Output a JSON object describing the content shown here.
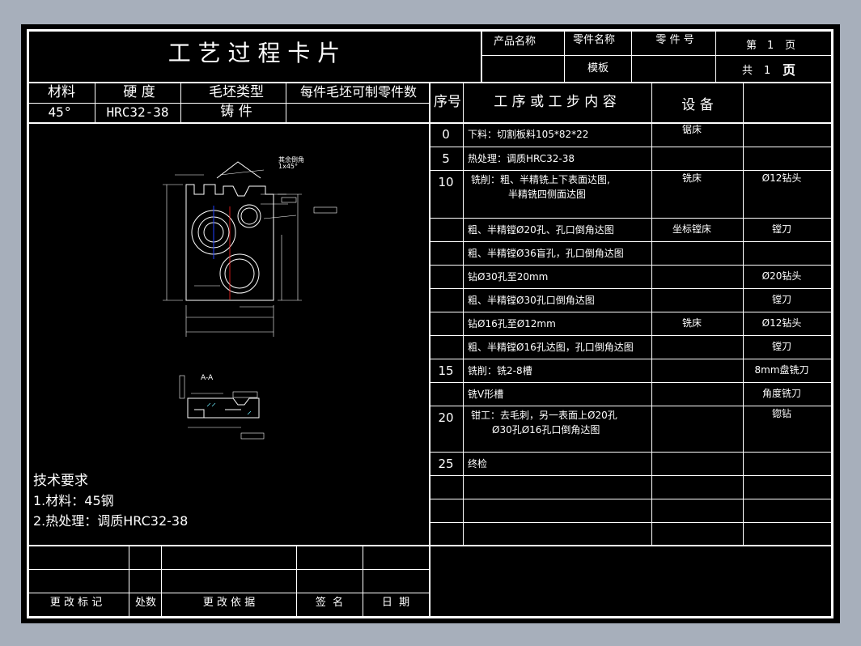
{
  "title": "工 艺 过 程 卡 片",
  "header": {
    "product_name_label": "产品名称",
    "part_name_label": "零件名称",
    "part_no_label": "零 件 号",
    "template_label": "模板",
    "sheet_label": "第",
    "sheet_no": "1",
    "sheet_unit": "页",
    "total_label": "共",
    "total_no": "1",
    "total_unit": "页"
  },
  "material_table": {
    "headers": [
      "材料",
      "硬 度",
      "毛坯类型",
      "每件毛坯可制零件数"
    ],
    "values": [
      "45°",
      "HRC32-38",
      "铸 件",
      ""
    ]
  },
  "process_table": {
    "headers": [
      "序号",
      "工 序 或 工 步 内 容",
      "设 备",
      ""
    ],
    "rows": [
      {
        "no": "0",
        "content": "下料：切割板料105*82*22",
        "content2": "",
        "equipment": "锯床",
        "tool": ""
      },
      {
        "no": "5",
        "content": "热处理：调质HRC32-38",
        "content2": "",
        "equipment": "",
        "tool": ""
      },
      {
        "no": "10",
        "content": "铣削：粗、半精铣上下表面达图,",
        "content2": "半精铣四侧面达图",
        "equipment": "铣床",
        "tool": "Ø12钻头"
      },
      {
        "no": "",
        "content": "粗、半精镗Ø20孔、孔口倒角达图",
        "content2": "",
        "equipment": "坐标镗床",
        "tool": "镗刀"
      },
      {
        "no": "",
        "content": "粗、半精镗Ø36盲孔，孔口倒角达图",
        "content2": "",
        "equipment": "",
        "tool": ""
      },
      {
        "no": "",
        "content": "钻Ø30孔至20mm",
        "content2": "",
        "equipment": "",
        "tool": "Ø20钻头"
      },
      {
        "no": "",
        "content": "粗、半精镗Ø30孔口倒角达图",
        "content2": "",
        "equipment": "",
        "tool": "镗刀"
      },
      {
        "no": "",
        "content": "钻Ø16孔至Ø12mm",
        "content2": "",
        "equipment": "铣床",
        "tool": "Ø12钻头"
      },
      {
        "no": "",
        "content": "粗、半精镗Ø16孔达图，孔口倒角达图",
        "content2": "",
        "equipment": "",
        "tool": "镗刀"
      },
      {
        "no": "15",
        "content": "铣削：铣2-8槽",
        "content2": "",
        "equipment": "",
        "tool": "8mm盘铣刀"
      },
      {
        "no": "",
        "content": "铣V形槽",
        "content2": "",
        "equipment": "",
        "tool": "角度铣刀"
      },
      {
        "no": "20",
        "content": "钳工：去毛刺，另一表面上Ø20孔",
        "content2": "Ø30孔Ø16孔口倒角达图",
        "equipment": "",
        "tool": "锪钻"
      },
      {
        "no": "25",
        "content": "终检",
        "content2": "",
        "equipment": "",
        "tool": ""
      },
      {
        "no": "",
        "content": "",
        "content2": "",
        "equipment": "",
        "tool": ""
      },
      {
        "no": "",
        "content": "",
        "content2": "",
        "equipment": "",
        "tool": ""
      },
      {
        "no": "",
        "content": "",
        "content2": "",
        "equipment": "",
        "tool": ""
      }
    ]
  },
  "tech_requirements": {
    "title": "技术要求",
    "items": [
      "1.材料：45钢",
      "2.热处理：调质HRC32-38"
    ]
  },
  "revision_table": {
    "labels": [
      "更 改 标 记",
      "处数",
      "更 改 依 据",
      "签  名",
      "日  期"
    ]
  },
  "drawing": {
    "section_label": "A-A",
    "chamfer_note": "其余倒角1x45°",
    "line_color": "#ffffff",
    "centerline_color": "#ff2020",
    "axis_color": "#2040ff"
  }
}
